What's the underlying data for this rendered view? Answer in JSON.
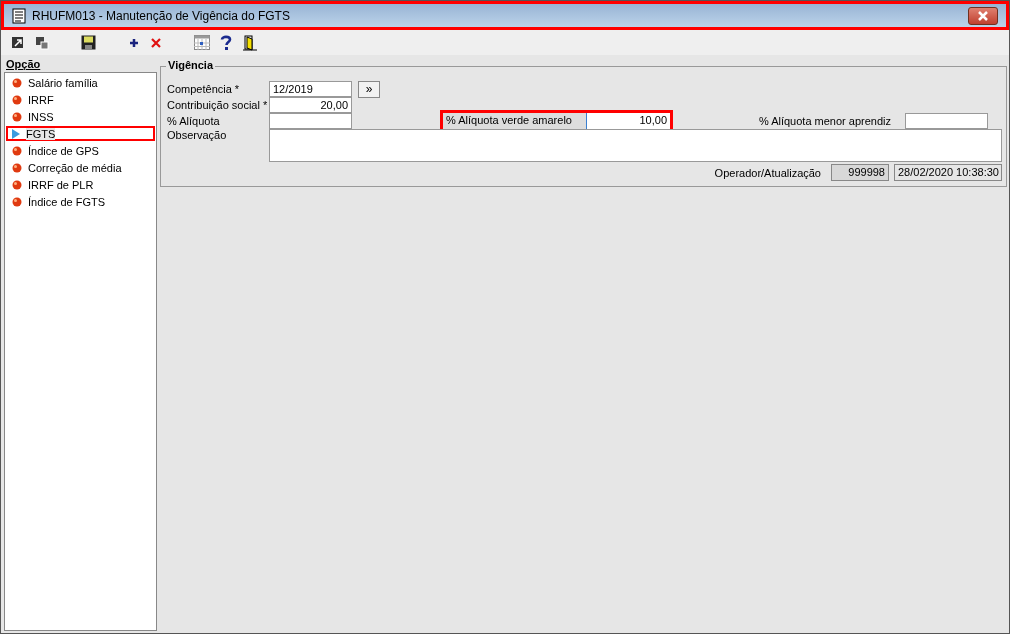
{
  "window": {
    "title": "RHUFM013 - Manutenção de Vigência do FGTS",
    "highlighted": true
  },
  "toolbar": [
    {
      "kind": "export"
    },
    {
      "kind": "copy"
    },
    {
      "kind": "save"
    },
    {
      "kind": "add"
    },
    {
      "kind": "delete"
    },
    {
      "kind": "calendar"
    },
    {
      "kind": "help"
    },
    {
      "kind": "exit"
    }
  ],
  "sidebar": {
    "title": "Opção",
    "items": [
      {
        "label": "Salário família",
        "selected": false,
        "highlighted": false
      },
      {
        "label": "IRRF",
        "selected": false,
        "highlighted": false
      },
      {
        "label": "INSS",
        "selected": false,
        "highlighted": false
      },
      {
        "label": "FGTS",
        "selected": true,
        "highlighted": true
      },
      {
        "label": "Índice de GPS",
        "selected": false,
        "highlighted": false
      },
      {
        "label": "Correção de média",
        "selected": false,
        "highlighted": false
      },
      {
        "label": "IRRF de PLR",
        "selected": false,
        "highlighted": false
      },
      {
        "label": "Índice de FGTS",
        "selected": false,
        "highlighted": false
      }
    ]
  },
  "form": {
    "title": "Vigência",
    "competencia": {
      "label": "Competência *",
      "value": "12/2019",
      "button": "»"
    },
    "contribuicao": {
      "label": "Contribuição social *",
      "value": "20,00"
    },
    "aliquota": {
      "label": "% Alíquota"
    },
    "aliquota_verde_amarelo": {
      "label": "% Alíquota verde amarelo",
      "value": "10,00",
      "highlighted": true
    },
    "aliquota_menor_aprendiz": {
      "label": "% Alíquota menor aprendiz"
    },
    "observacao": {
      "label": "Observação"
    },
    "operador": {
      "label": "Operador/Atualização",
      "operator": "999998",
      "updated": "28/02/2020 10:38:30"
    }
  }
}
